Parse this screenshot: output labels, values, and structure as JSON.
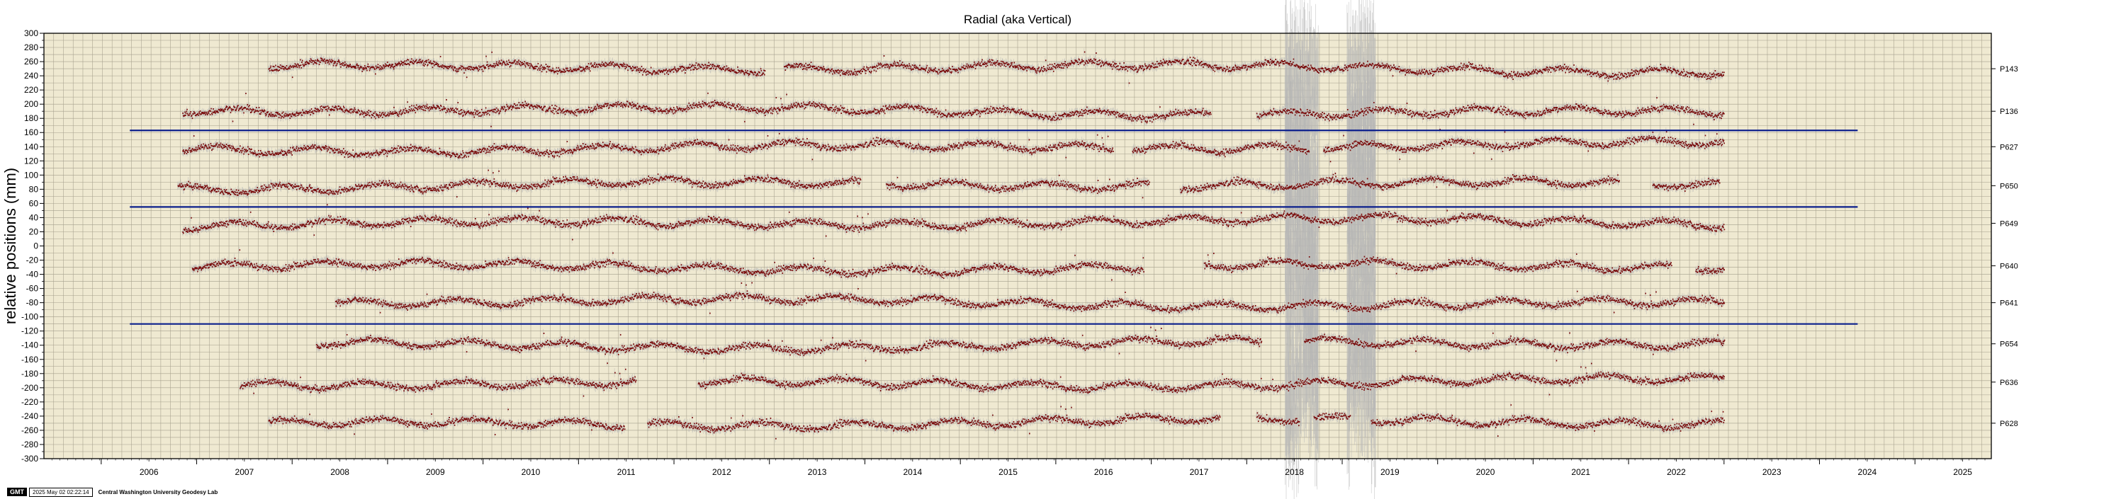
{
  "chart_data": {
    "type": "scatter",
    "title": "Radial (aka Vertical)",
    "xlabel": "",
    "ylabel": "relative positions (mm)",
    "xlim": [
      2005.4,
      2025.8
    ],
    "ylim": [
      -300,
      300
    ],
    "x_ticks": [
      "2006",
      "2007",
      "2008",
      "2009",
      "2010",
      "2011",
      "2012",
      "2013",
      "2014",
      "2015",
      "2016",
      "2017",
      "2018",
      "2019",
      "2020",
      "2021",
      "2022",
      "2023",
      "2024",
      "2025"
    ],
    "y_ticks": [
      300,
      280,
      260,
      240,
      220,
      200,
      180,
      160,
      140,
      120,
      100,
      80,
      60,
      40,
      20,
      0,
      -20,
      -40,
      -60,
      -80,
      -100,
      -120,
      -140,
      -160,
      -180,
      -200,
      -220,
      -240,
      -260,
      -280,
      -300
    ],
    "grid": true,
    "background_color": "#efe9d1",
    "point_color": "#7a0c0c",
    "error_color": "#b5b5b5",
    "separator_color": "#0b1f8c",
    "separators": [
      {
        "y": 163,
        "x_start": 2006.3,
        "x_end": 2024.4
      },
      {
        "y": 55,
        "x_start": 2006.3,
        "x_end": 2024.4
      },
      {
        "y": -110,
        "x_start": 2006.3,
        "x_end": 2024.4
      }
    ],
    "series": [
      {
        "name": "P143",
        "offset": 250,
        "segments": [
          [
            2007.75,
            2012.95
          ],
          [
            2013.15,
            2023.0
          ]
        ]
      },
      {
        "name": "P136",
        "offset": 190,
        "segments": [
          [
            2006.85,
            2017.62
          ],
          [
            2018.1,
            2023.0
          ]
        ]
      },
      {
        "name": "P627",
        "offset": 140,
        "segments": [
          [
            2006.85,
            2016.6
          ],
          [
            2016.8,
            2018.65
          ],
          [
            2018.8,
            2023.0
          ]
        ]
      },
      {
        "name": "P650",
        "offset": 85,
        "segments": [
          [
            2006.8,
            2013.95
          ],
          [
            2014.22,
            2016.98
          ],
          [
            2017.3,
            2021.9
          ],
          [
            2022.25,
            2022.95
          ]
        ]
      },
      {
        "name": "P649",
        "offset": 32,
        "segments": [
          [
            2006.85,
            2023.0
          ]
        ]
      },
      {
        "name": "P640",
        "offset": -28,
        "segments": [
          [
            2006.95,
            2016.92
          ],
          [
            2017.55,
            2022.45
          ],
          [
            2022.7,
            2023.0
          ]
        ]
      },
      {
        "name": "P641",
        "offset": -80,
        "segments": [
          [
            2008.45,
            2023.0
          ]
        ]
      },
      {
        "name": "P654",
        "offset": -138,
        "segments": [
          [
            2008.25,
            2018.15
          ],
          [
            2018.6,
            2023.0
          ]
        ]
      },
      {
        "name": "P636",
        "offset": -192,
        "segments": [
          [
            2007.45,
            2011.6
          ],
          [
            2012.25,
            2023.0
          ]
        ]
      },
      {
        "name": "P628",
        "offset": -250,
        "segments": [
          [
            2007.75,
            2011.48
          ],
          [
            2011.72,
            2017.72
          ],
          [
            2018.1,
            2018.55
          ],
          [
            2018.7,
            2019.08
          ],
          [
            2019.3,
            2023.0
          ]
        ]
      }
    ]
  },
  "footer": {
    "logo": "GMT",
    "timestamp": "2025 May 02 02:22:14",
    "credit": "Central Washington University Geodesy Lab"
  }
}
